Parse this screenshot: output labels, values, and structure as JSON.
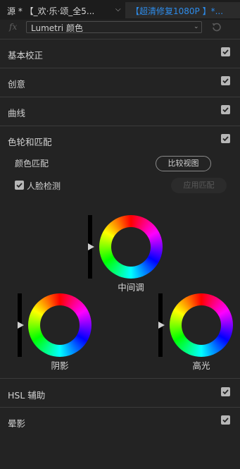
{
  "header": {
    "source_label": "源 * 【_欢·乐·颂_全5...",
    "sequence_tab": "【超清修复1080P 】*..."
  },
  "effect_row": {
    "fx_label": "fx",
    "selected_effect": "Lumetri 颜色"
  },
  "sections": [
    {
      "title": "基本校正",
      "checked": true
    },
    {
      "title": "创意",
      "checked": true
    },
    {
      "title": "曲线",
      "checked": true
    },
    {
      "title": "色轮和匹配",
      "checked": true
    },
    {
      "title": "HSL 辅助",
      "checked": true
    },
    {
      "title": "晕影",
      "checked": true
    }
  ],
  "color_match": {
    "label": "颜色匹配",
    "compare_button": "比较视图",
    "face_detect_label": "人脸检测",
    "face_detect_checked": true,
    "apply_button": "应用匹配"
  },
  "wheels": {
    "midtones": "中间调",
    "shadows": "阴影",
    "highlights": "高光"
  },
  "colors": {
    "background": "#232323",
    "accent_blue": "#2d8ceb",
    "checkbox": "#b7b7b7"
  }
}
